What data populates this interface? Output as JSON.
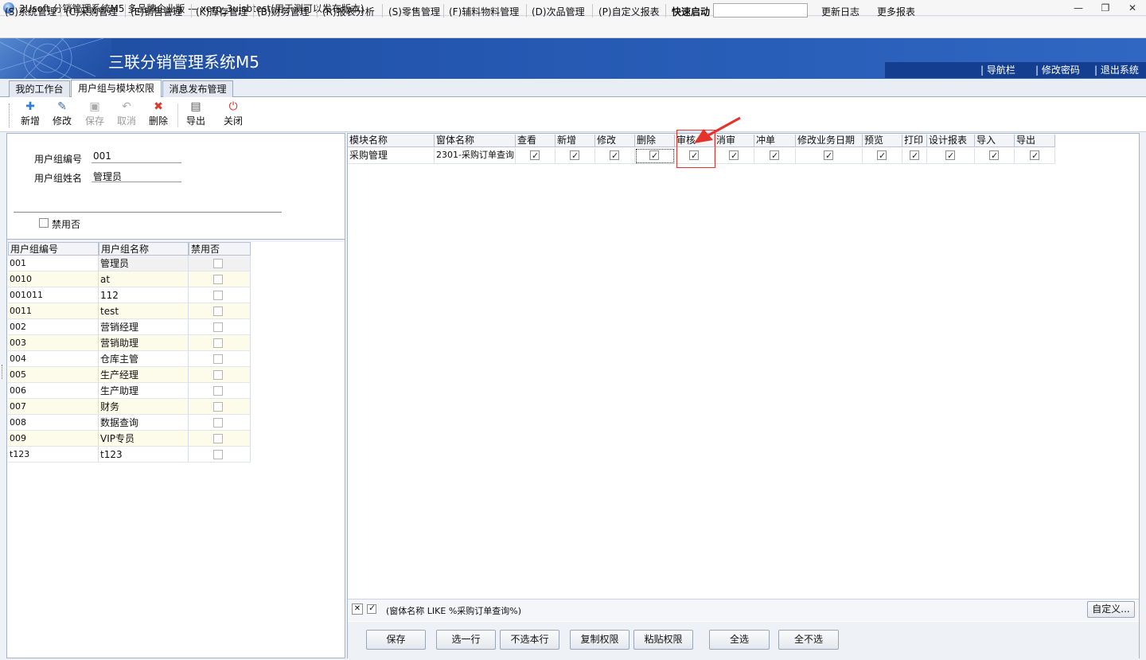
{
  "window": {
    "title": "3Usoft 分销管理系统M5 多品牌企业版 — xerp_3ujsbtest(用于测可以发布版本)",
    "controls": [
      "—",
      "❐",
      "✕"
    ]
  },
  "menu": {
    "items": [
      {
        "key": "S",
        "label": "系统管理"
      },
      {
        "key": "C",
        "label": "采购管理"
      },
      {
        "key": "E",
        "label": "销售管理"
      },
      {
        "key": "K",
        "label": "库存管理"
      },
      {
        "key": "B",
        "label": "财务管理"
      },
      {
        "key": "R",
        "label": "报表分析"
      },
      {
        "key": "S",
        "label": "零售管理"
      },
      {
        "key": "F",
        "label": "辅料物料管理"
      },
      {
        "key": "D",
        "label": "次品管理"
      },
      {
        "key": "P",
        "label": "自定义报表"
      }
    ],
    "quick_start_label": "快速启动",
    "quick_start_value": "",
    "update_log": "更新日志",
    "more_reports": "更多报表"
  },
  "banner": {
    "title": "三联分销管理系统M5",
    "links": [
      "导航栏",
      "修改密码",
      "退出系统"
    ]
  },
  "tabs": [
    {
      "label": "我的工作台",
      "active": false
    },
    {
      "label": "用户组与模块权限",
      "active": true
    },
    {
      "label": "消息发布管理",
      "active": false
    }
  ],
  "toolbar": {
    "buttons": [
      {
        "label": "新增",
        "icon": "add-icon",
        "enabled": true
      },
      {
        "label": "修改",
        "icon": "edit-icon",
        "enabled": true
      },
      {
        "label": "保存",
        "icon": "save-icon",
        "enabled": false
      },
      {
        "label": "取消",
        "icon": "undo-icon",
        "enabled": false
      },
      {
        "label": "删除",
        "icon": "delete-icon",
        "enabled": true
      },
      {
        "label": "导出",
        "icon": "export-icon",
        "enabled": true
      },
      {
        "label": "关闭",
        "icon": "close-icon",
        "enabled": true
      }
    ]
  },
  "form": {
    "code_label": "用户组编号",
    "code_value": "001",
    "name_label": "用户组姓名",
    "name_value": "管理员",
    "disabled_label": "禁用否",
    "disabled_checked": false
  },
  "group_grid": {
    "headers": [
      "用户组编号",
      "用户组名称",
      "禁用否"
    ],
    "rows": [
      [
        "001",
        "管理员"
      ],
      [
        "0010",
        "at"
      ],
      [
        "001011",
        "112"
      ],
      [
        "0011",
        "test"
      ],
      [
        "002",
        "营销经理"
      ],
      [
        "003",
        "营销助理"
      ],
      [
        "004",
        "仓库主管"
      ],
      [
        "005",
        "生产经理"
      ],
      [
        "006",
        "生产助理"
      ],
      [
        "007",
        "财务"
      ],
      [
        "008",
        "数据查询"
      ],
      [
        "009",
        "VIP专员"
      ],
      [
        "t123",
        "t123"
      ]
    ]
  },
  "perm_grid": {
    "headers": [
      "模块名称",
      "窗体名称",
      "查看",
      "新增",
      "修改",
      "删除",
      "审核",
      "消审",
      "冲单",
      "修改业务日期",
      "预览",
      "打印",
      "设计报表",
      "导入",
      "导出"
    ],
    "rows": [
      {
        "module": "采购管理",
        "form": "2301-采购订单查询",
        "checks": [
          true,
          true,
          true,
          true,
          true,
          true,
          true,
          true,
          true,
          true,
          true,
          true,
          true
        ]
      }
    ]
  },
  "filter": {
    "text": "(窗体名称 LIKE %采购订单查询%)",
    "enabled": true,
    "customize": "自定义..."
  },
  "bottom_buttons": [
    "保存",
    "选一行",
    "不选本行",
    "复制权限",
    "粘贴权限",
    "全选",
    "全不选"
  ],
  "colors": {
    "banner": "#2457b0",
    "highlight": "#e5322b",
    "accent_icon_blue": "#2f7fd8",
    "delete_red": "#d93a2b"
  }
}
